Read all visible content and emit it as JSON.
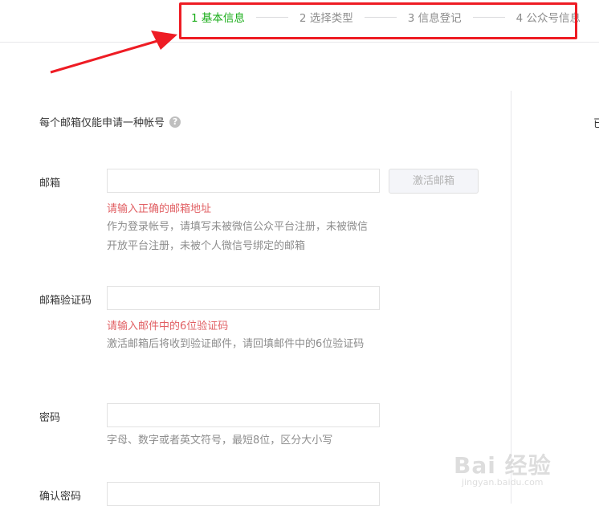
{
  "steps": [
    {
      "label": "1 基本信息",
      "active": true
    },
    {
      "label": "2 选择类型",
      "active": false
    },
    {
      "label": "3 信息登记",
      "active": false
    },
    {
      "label": "4 公众号信息",
      "active": false
    }
  ],
  "notice": {
    "text": "每个邮箱仅能申请一种帐号",
    "icon": "question-icon"
  },
  "right_cut_text": "已",
  "form": {
    "email": {
      "label": "邮箱",
      "value": "",
      "button": "激活邮箱",
      "error": "请输入正确的邮箱地址",
      "tip": "作为登录帐号，请填写未被微信公众平台注册，未被微信开放平台注册，未被个人微信号绑定的邮箱"
    },
    "code": {
      "label": "邮箱验证码",
      "value": "",
      "error": "请输入邮件中的6位验证码",
      "tip": "激活邮箱后将收到验证邮件，请回填邮件中的6位验证码"
    },
    "password": {
      "label": "密码",
      "value": "",
      "tip": "字母、数字或者英文符号，最短8位，区分大小写"
    },
    "confirm": {
      "label": "确认密码",
      "value": ""
    }
  },
  "watermark": {
    "main": "Bai 经验",
    "sub": "jingyan.baidu.com"
  },
  "colors": {
    "active_step": "#1aad19",
    "error": "#e15f63",
    "highlight": "#ee1c24",
    "tip": "#8d8d8d"
  }
}
